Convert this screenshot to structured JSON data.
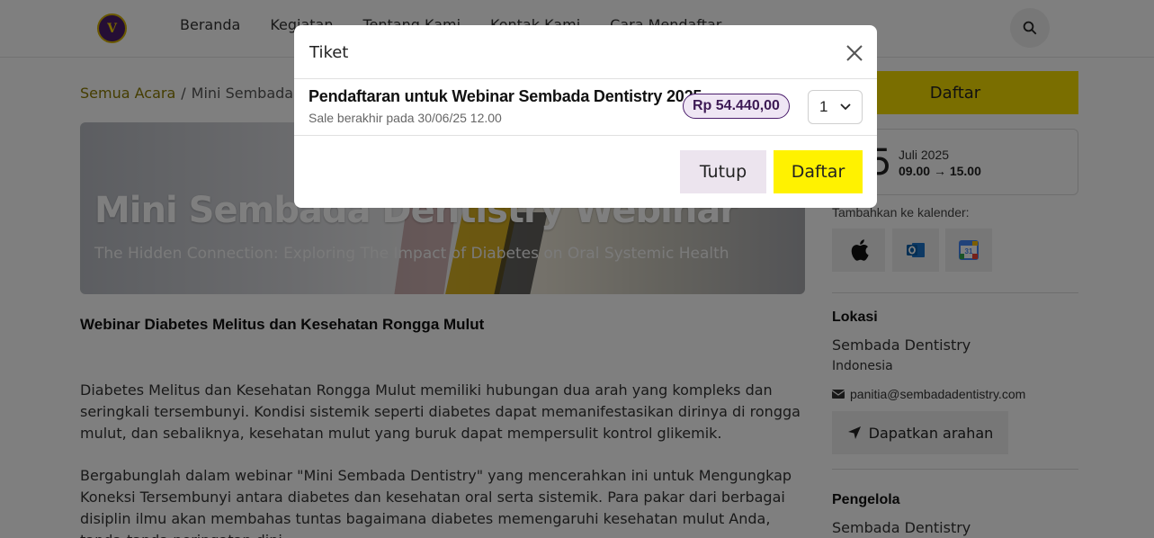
{
  "header": {
    "nav": [
      "Beranda",
      "Kegiatan",
      "Tentang Kami",
      "Kontak Kami",
      "Cara Mendaftar"
    ]
  },
  "breadcrumb": {
    "root": "Semua Acara",
    "separator": "/",
    "current": "Mini Sembada D"
  },
  "hero": {
    "title": "Mini Sembada Dentistry Webinar",
    "subtitle": "The Hidden Connection: Exploring The Impact of Diabetes on Oral Systemic Health"
  },
  "content": {
    "heading": "Webinar Diabetes Melitus dan Kesehatan Rongga Mulut",
    "paragraph1": "Diabetes Melitus dan Kesehatan Rongga Mulut memiliki hubungan dua arah yang kompleks dan seringkali tersembunyi. Kondisi sistemik seperti diabetes dapat memanifestasikan dirinya di rongga mulut, dan sebaliknya, kesehatan mulut yang buruk dapat mempersulit kontrol glikemik.",
    "paragraph2": "Bergabunglah dalam webinar \"Mini Sembada Dentistry\" yang mencerahkan ini untuk Mengungkap Koneksi Tersembunyi antara diabetes dan kesehatan oral serta sistemik. Para pakar dari berbagai disiplin ilmu akan membahas tuntas bagaimana diabetes memengaruhi kesehatan mulut Anda, tanda-tanda peringatan dini"
  },
  "sidebar": {
    "register_label": "Daftar",
    "date_day": "5",
    "date_month": "Juli 2025",
    "time_start": "09.00",
    "time_arrow": "→",
    "time_end": "15.00",
    "calendar_label": "Tambahkan ke kalender:",
    "location_heading": "Lokasi",
    "location_name": "Sembada Dentistry",
    "location_country": "Indonesia",
    "email": "panitia@sembadadentistry.com",
    "directions_label": "Dapatkan arahan",
    "organizer_heading": "Pengelola",
    "organizer_name": "Sembada Dentistry"
  },
  "modal": {
    "title": "Tiket",
    "ticket_name": "Pendaftaran untuk Webinar Sembada Dentistry 2025",
    "sale_end": "Sale berakhir pada 30/06/25 12.00",
    "price": "Rp 54.440,00",
    "quantity": "1",
    "close_label": "Tutup",
    "register_label": "Daftar"
  },
  "colors": {
    "accent_yellow": "#fff200",
    "brand_purple": "#4a1d6b",
    "price_bg": "#efe6f4"
  },
  "icons": [
    "search-icon",
    "close-icon",
    "chevron-down-icon",
    "apple-icon",
    "outlook-icon",
    "google-calendar-icon",
    "envelope-icon",
    "navigation-arrow-icon"
  ]
}
